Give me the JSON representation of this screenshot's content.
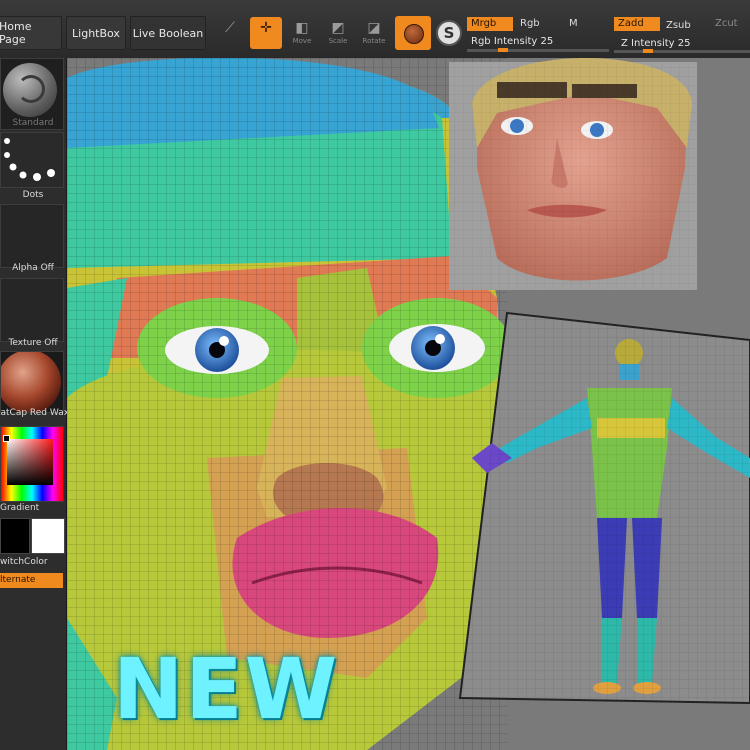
{
  "toolbar": {
    "home_label": "Home Page",
    "lightbox_label": "LightBox",
    "live_boolean_label": "Live Boolean",
    "tools": [
      {
        "label": "",
        "icon": "edit-icon"
      },
      {
        "label": "",
        "icon": "draw-icon",
        "active": true
      },
      {
        "label": "Move",
        "icon": "move-icon"
      },
      {
        "label": "Scale",
        "icon": "scale-icon"
      },
      {
        "label": "Rotate",
        "icon": "rotate-icon"
      }
    ],
    "modes": {
      "mrgb": "Mrgb",
      "rgb": "Rgb",
      "m": "M",
      "zadd": "Zadd",
      "zsub": "Zsub",
      "zcut": "Zcut"
    },
    "rgb_intensity_label": "Rgb Intensity",
    "rgb_intensity_value": "25",
    "z_intensity_label": "Z Intensity",
    "z_intensity_value": "25",
    "rgb_intensity_level": 0.25,
    "z_intensity_level": 0.25
  },
  "sidebar": {
    "brush_label": "Standard",
    "stroke_label": "Dots",
    "alpha_label": "Alpha Off",
    "texture_label": "Texture Off",
    "material_label": "latCap Red Wax",
    "gradient_label": "Gradient",
    "switch_color_label": "witchColor",
    "alternate_label": "lternate"
  },
  "overlay": {
    "headline": "NEW"
  },
  "colors": {
    "accent": "#f08a1e",
    "new_text": "#6ff2ff"
  }
}
